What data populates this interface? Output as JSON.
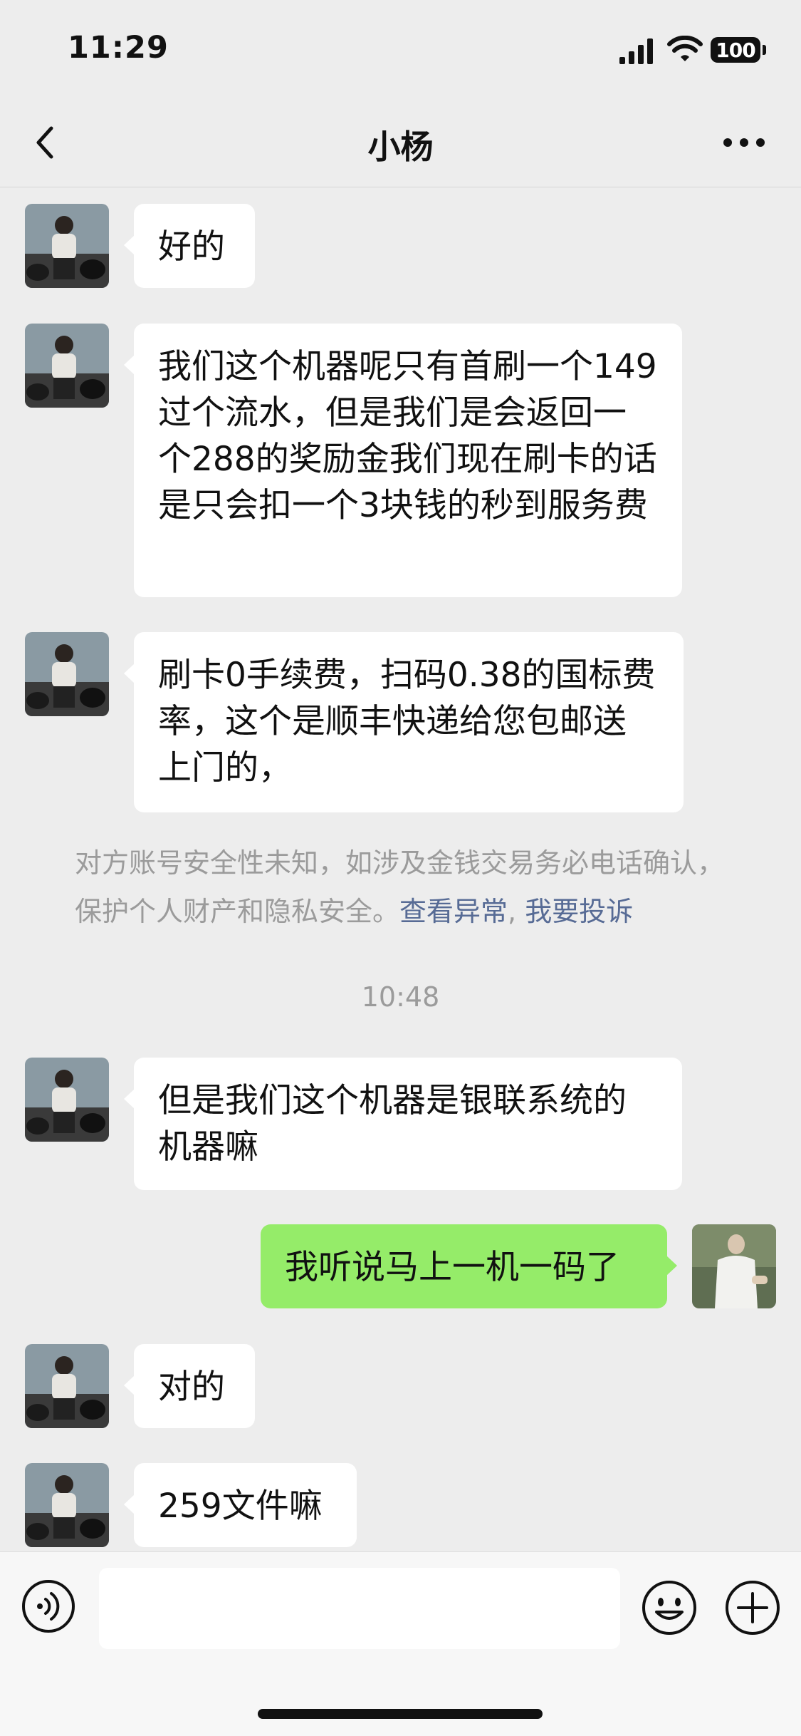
{
  "status_bar": {
    "time": "11:29",
    "battery": "100"
  },
  "header": {
    "title": "小杨"
  },
  "messages": [
    {
      "from": "other",
      "text": "好的"
    },
    {
      "from": "other",
      "text": "我们这个机器呢只有首刷一个149过个流水，但是我们是会返回一个288的奖励金我们现在刷卡的话是只会扣一个3块钱的秒到服务费"
    },
    {
      "from": "other",
      "text": "刷卡0手续费，扫码0.38的国标费率，这个是顺丰快递给您包邮送上门的，"
    },
    {
      "from": "other",
      "text": "但是我们这个机器是银联系统的机器嘛"
    },
    {
      "from": "self",
      "text": "我听说马上一机一码了"
    },
    {
      "from": "other",
      "text": "对的"
    },
    {
      "from": "other",
      "text": "259文件嘛"
    }
  ],
  "system_notice": {
    "text": "对方账号安全性未知，如涉及金钱交易务必电话确认，保护个人财产和隐私安全。",
    "link_view": "查看异常",
    "separator": ",",
    "link_report": "我要投诉"
  },
  "timestamp": "10:48",
  "input_bar": {
    "placeholder": ""
  },
  "icons": {
    "back": "chevron-left-icon",
    "more": "more-dots-icon",
    "voice": "voice-icon",
    "emoji": "emoji-icon",
    "plus": "plus-icon"
  },
  "colors": {
    "self_bubble": "#95ec69",
    "link": "#576b95",
    "background": "#ededed"
  }
}
